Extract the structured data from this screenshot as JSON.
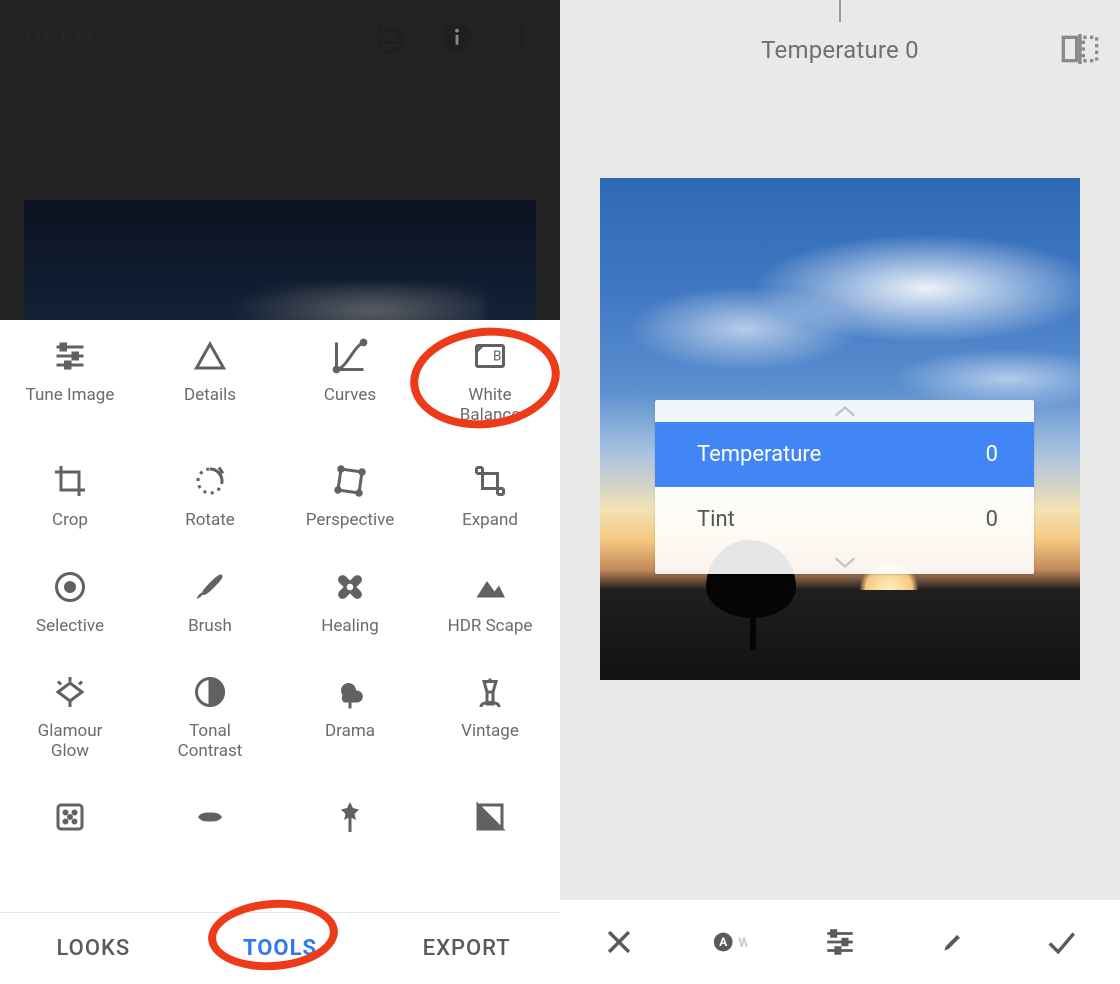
{
  "left": {
    "open_label": "OPEN",
    "tabs": {
      "looks": "LOOKS",
      "tools": "TOOLS",
      "export": "EXPORT",
      "active": "tools"
    },
    "top_icons": [
      "undo-icon",
      "info-icon",
      "more-icon"
    ],
    "tools": [
      [
        {
          "name": "tune-image",
          "label": "Tune Image"
        },
        {
          "name": "details",
          "label": "Details"
        },
        {
          "name": "curves",
          "label": "Curves"
        },
        {
          "name": "white-balance",
          "label": "White\nBalance"
        }
      ],
      [
        {
          "name": "crop",
          "label": "Crop"
        },
        {
          "name": "rotate",
          "label": "Rotate"
        },
        {
          "name": "perspective",
          "label": "Perspective"
        },
        {
          "name": "expand",
          "label": "Expand"
        }
      ],
      [
        {
          "name": "selective",
          "label": "Selective"
        },
        {
          "name": "brush",
          "label": "Brush"
        },
        {
          "name": "healing",
          "label": "Healing"
        },
        {
          "name": "hdr-scape",
          "label": "HDR Scape"
        }
      ],
      [
        {
          "name": "glamour-glow",
          "label": "Glamour\nGlow"
        },
        {
          "name": "tonal-contrast",
          "label": "Tonal\nContrast"
        },
        {
          "name": "drama",
          "label": "Drama"
        },
        {
          "name": "vintage",
          "label": "Vintage"
        }
      ],
      [
        {
          "name": "grainy-film",
          "label": ""
        },
        {
          "name": "retrolux",
          "label": ""
        },
        {
          "name": "grunge",
          "label": ""
        },
        {
          "name": "black-white",
          "label": ""
        }
      ]
    ]
  },
  "right": {
    "title_param": "Temperature",
    "title_value": "0",
    "params": [
      {
        "name": "Temperature",
        "value": "0",
        "selected": true
      },
      {
        "name": "Tint",
        "value": "0",
        "selected": false
      }
    ],
    "bottom_icons": [
      "close-icon",
      "auto-wb-icon",
      "adjust-icon",
      "eyedropper-icon",
      "apply-icon"
    ]
  },
  "colors": {
    "accent": "#4285f4",
    "annotation": "#ed3b1a"
  }
}
